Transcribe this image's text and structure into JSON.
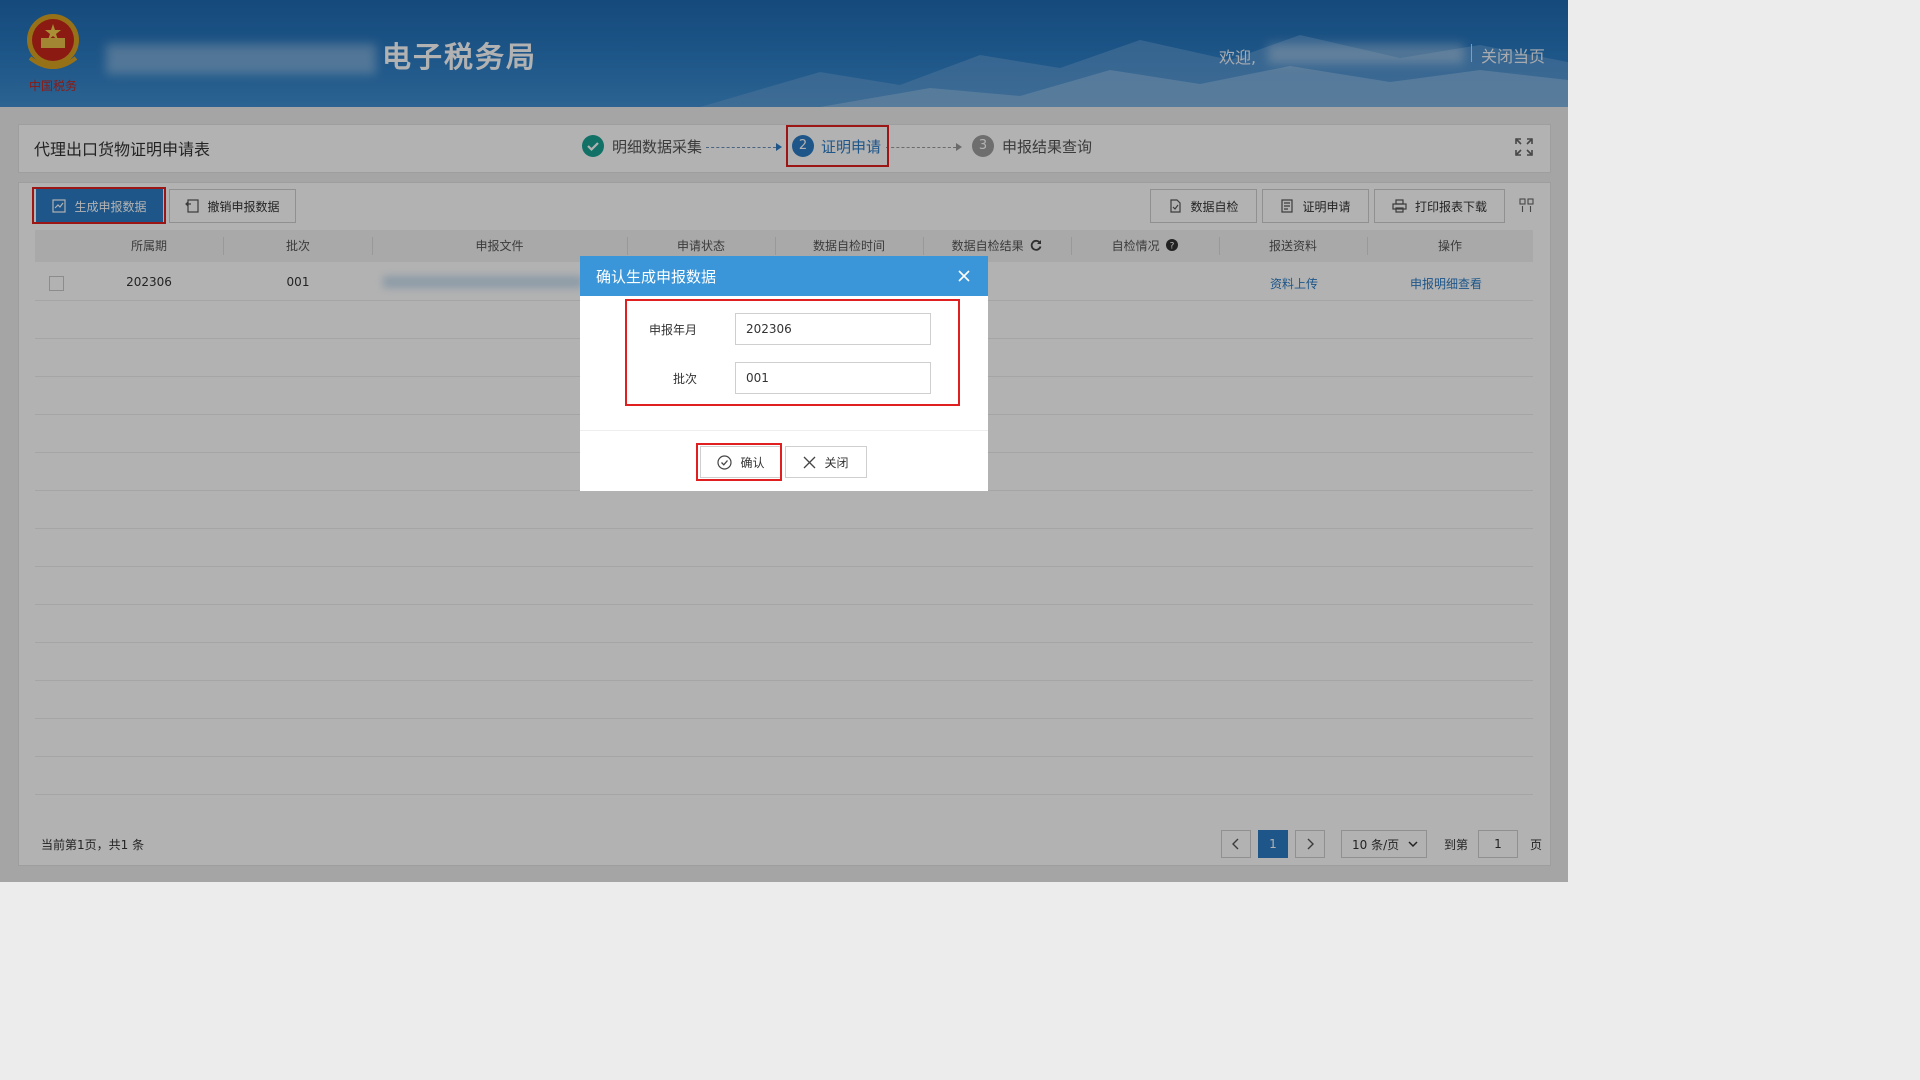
{
  "header": {
    "site_title": "电子税务局",
    "welcome": "欢迎,",
    "close_page": "关闭当页",
    "logo_text": "中国税务"
  },
  "page": {
    "title": "代理出口货物证明申请表"
  },
  "steps": [
    {
      "num": "✔",
      "label": "明细数据采集",
      "state": "done"
    },
    {
      "num": "2",
      "label": "证明申请",
      "state": "active"
    },
    {
      "num": "3",
      "label": "申报结果查询",
      "state": "pending"
    }
  ],
  "toolbar": {
    "generate": "生成申报数据",
    "revoke": "撤销申报数据",
    "self_check": "数据自检",
    "apply": "证明申请",
    "print": "打印报表下载"
  },
  "table": {
    "headers": [
      "所属期",
      "批次",
      "申报文件",
      "申请状态",
      "数据自检时间",
      "数据自检结果",
      "自检情况",
      "报送资料",
      "操作"
    ],
    "rows": [
      {
        "period": "202306",
        "batch": "001",
        "upload": "资料上传",
        "detail": "申报明细查看"
      }
    ]
  },
  "footer": {
    "summary": "当前第1页，共1 条",
    "current_page": "1",
    "page_size": "10 条/页",
    "goto_label": "到第",
    "goto_value": "1",
    "page_unit": "页"
  },
  "modal": {
    "title": "确认生成申报数据",
    "year_month_label": "申报年月",
    "year_month_value": "202306",
    "batch_label": "批次",
    "batch_value": "001",
    "confirm": "确认",
    "close": "关闭"
  },
  "colors": {
    "primary": "#2b7cc4",
    "modal_header": "#3a96d8",
    "highlight": "#e02020",
    "done": "#1aa394"
  }
}
